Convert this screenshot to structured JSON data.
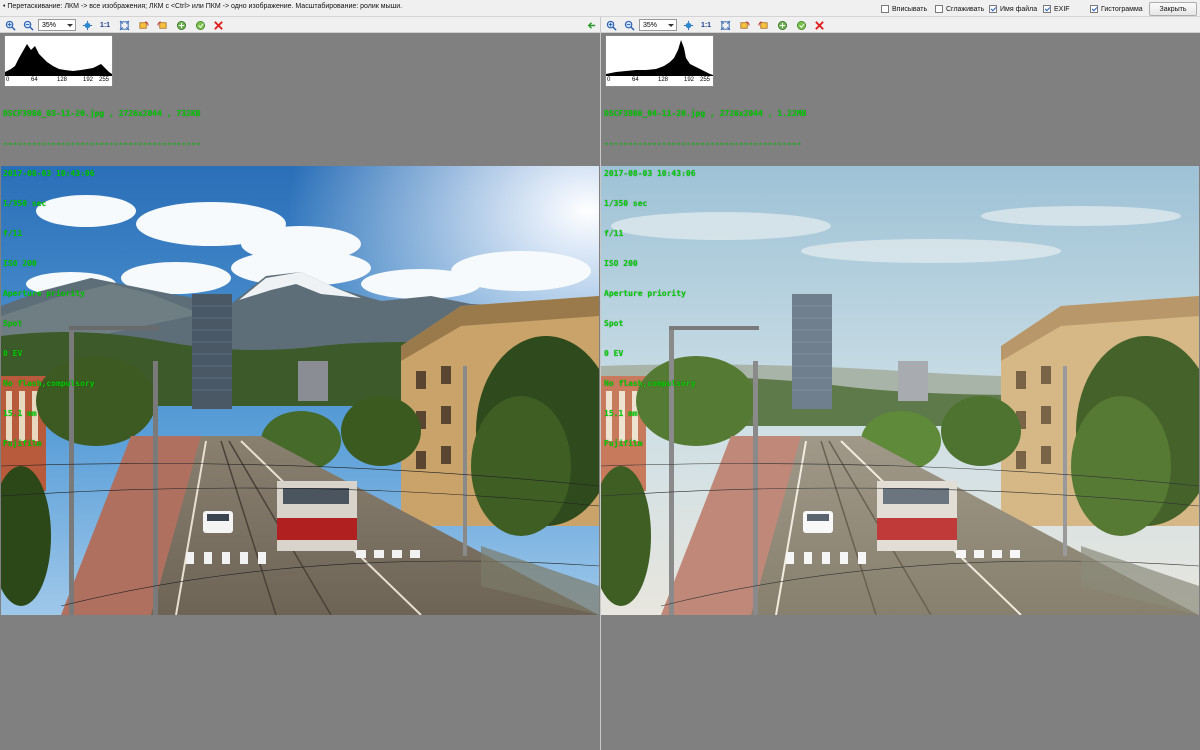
{
  "topbar": {
    "hint": "• Перетаскивание: ЛКМ -> все изображения; ЛКМ с <Ctrl> или ПКМ -> одно изображение. Масштабирование: ролик мыши.",
    "options": [
      {
        "label": "Вписывать",
        "checked": false
      },
      {
        "label": "Сглаживать",
        "checked": false
      },
      {
        "label": "Имя файла",
        "checked": true
      },
      {
        "label": "EXIF",
        "checked": true
      },
      {
        "label": "Гистограмма",
        "checked": true
      }
    ],
    "close_label": "Закрыть"
  },
  "toolbar": {
    "zoom_value": "35%",
    "one_to_one": "1:1",
    "icons": [
      "zoom-in-icon",
      "zoom-out-icon",
      "fit-icon",
      "one-to-one-icon",
      "fit-window-icon",
      "rotate-left-icon",
      "rotate-right-icon",
      "flip-icon",
      "info-icon",
      "close-image-icon",
      "back-arrow-icon"
    ]
  },
  "histogram_ticks": [
    "0",
    "64",
    "128",
    "192",
    "255"
  ],
  "left": {
    "file_line": "DSCF3986_03-11-20.jpg , 2726x2044 , 732KB",
    "separator": "-----------------------------------------",
    "exif": [
      "2017-08-03 10:43:06",
      "1/350 sec",
      "f/11",
      "ISO 200",
      "Aperture priority",
      "Spot",
      "0 EV",
      "No flash,compulsory",
      "15.1 mm",
      "Fujifilm"
    ]
  },
  "right": {
    "file_line": "DSCF3986_04-11-20.jpg , 2726x2044 , 1.22MB",
    "separator": "-----------------------------------------",
    "exif": [
      "2017-08-03 10:43:06",
      "1/350 sec",
      "f/11",
      "ISO 200",
      "Aperture priority",
      "Spot",
      "0 EV",
      "No flash,compulsory",
      "15.1 mm",
      "Fujifilm"
    ]
  },
  "colors": {
    "exif_text": "#00d000",
    "background": "#808080",
    "toolbar": "#f0f0f0"
  }
}
